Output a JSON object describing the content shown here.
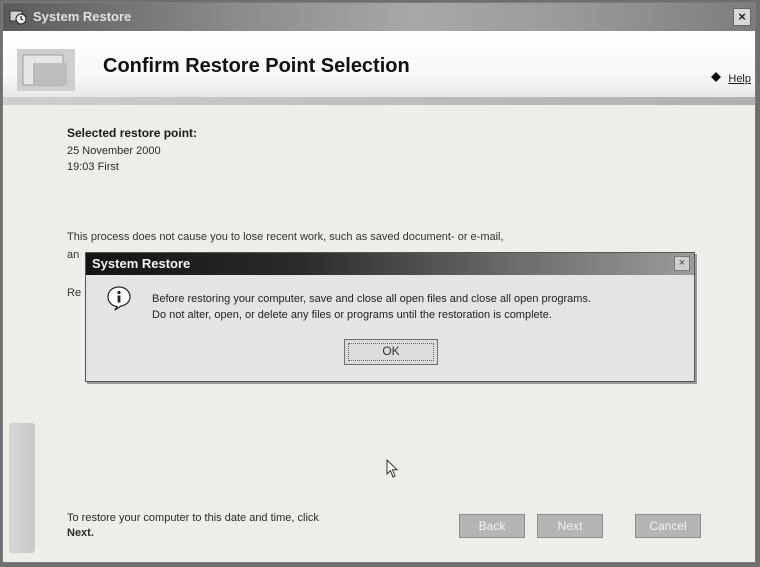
{
  "window": {
    "title": "System Restore",
    "close_glyph": "×"
  },
  "header": {
    "page_title": "Confirm Restore Point Selection",
    "help_label": "Help"
  },
  "content": {
    "selected_label": "Selected restore point:",
    "restore_date": "25 November 2000",
    "restore_time": "19:03 First",
    "info_text": "This process does not cause you to lose recent work, such as saved document- or e-mail,",
    "fragment_an": "an",
    "fragment_re": "Re",
    "footer_line1": "To restore your computer to this date and time, click",
    "footer_line2": "Next."
  },
  "buttons": {
    "back": "Back",
    "next": "Next",
    "cancel": "Cancel"
  },
  "modal": {
    "title": "System Restore",
    "close_glyph": "×",
    "message_line1": "Before restoring your computer, save and close all open files and close all open programs.",
    "message_line2": "Do not alter, open, or delete any files or programs until the restoration is complete.",
    "ok_label": "OK"
  },
  "icons": {
    "app": "system-restore-icon",
    "help": "help-icon",
    "info": "info-icon",
    "cursor": "mouse-cursor-icon"
  }
}
